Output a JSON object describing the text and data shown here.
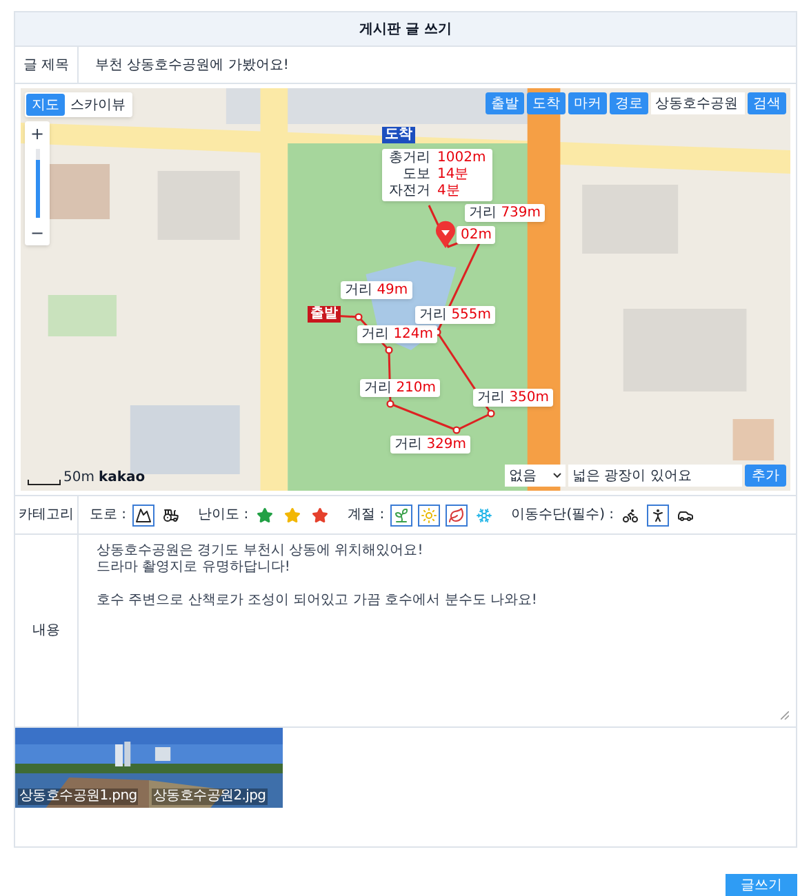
{
  "page_title": "게시판 글 쓰기",
  "title_row": {
    "label": "글 제목",
    "value": "부천 상동호수공원에 가봤어요!"
  },
  "map": {
    "view_toggle": [
      {
        "label": "지도",
        "selected": true
      },
      {
        "label": "스카이뷰",
        "selected": false
      }
    ],
    "zoom": {
      "in": "+",
      "out": "−",
      "level": 0.85
    },
    "tools": [
      "출발",
      "도착",
      "마커",
      "경로"
    ],
    "search": {
      "value": "상동호수공원",
      "button": "검색"
    },
    "route": {
      "start_label": "출발",
      "end_label": "도착",
      "summary": [
        {
          "name": "총거리",
          "value": "1002m"
        },
        {
          "name": "도보",
          "value": "14분"
        },
        {
          "name": "자전거",
          "value": "4분"
        }
      ],
      "segments": [
        {
          "name": "거리",
          "value": "49m"
        },
        {
          "name": "거리",
          "value": "124m"
        },
        {
          "name": "거리",
          "value": "210m"
        },
        {
          "name": "거리",
          "value": "329m"
        },
        {
          "name": "거리",
          "value": "350m"
        },
        {
          "name": "거리",
          "value": "555m"
        },
        {
          "name": "거리",
          "value": "739m"
        },
        {
          "value": "02m"
        }
      ]
    },
    "scale": "50m",
    "logo": "kakao",
    "marker_form": {
      "select": "없음",
      "value": "넓은 광장이 있어요",
      "button": "추가"
    }
  },
  "category": {
    "label": "카테고리",
    "groups": [
      {
        "label": "도로 :",
        "options": [
          {
            "selected": true
          },
          {
            "selected": false
          }
        ]
      },
      {
        "label": "난이도 :",
        "options": [
          {
            "selected": false,
            "color": "#22a045"
          },
          {
            "selected": false,
            "color": "#f2b705"
          },
          {
            "selected": false,
            "color": "#e5412d"
          }
        ]
      },
      {
        "label": "계절 :",
        "options": [
          {
            "selected": true
          },
          {
            "selected": true
          },
          {
            "selected": true
          },
          {
            "selected": false
          }
        ]
      },
      {
        "label": "이동수단(필수) :",
        "options": [
          {
            "selected": false
          },
          {
            "selected": true
          },
          {
            "selected": false
          }
        ]
      }
    ]
  },
  "content": {
    "label": "내용",
    "paragraphs": [
      "상동호수공원은 경기도 부천시 상동에 위치해있어요!\n드라마 촬영지로 유명하답니다!",
      "호수 주변으로 산책로가 조성이 되어있고 가끔 호수에서 분수도 나와요!"
    ]
  },
  "attachments": [
    {
      "name": "상동호수공원1.png"
    },
    {
      "name": "상동호수공원2.jpg"
    }
  ],
  "submit": "글쓰기"
}
